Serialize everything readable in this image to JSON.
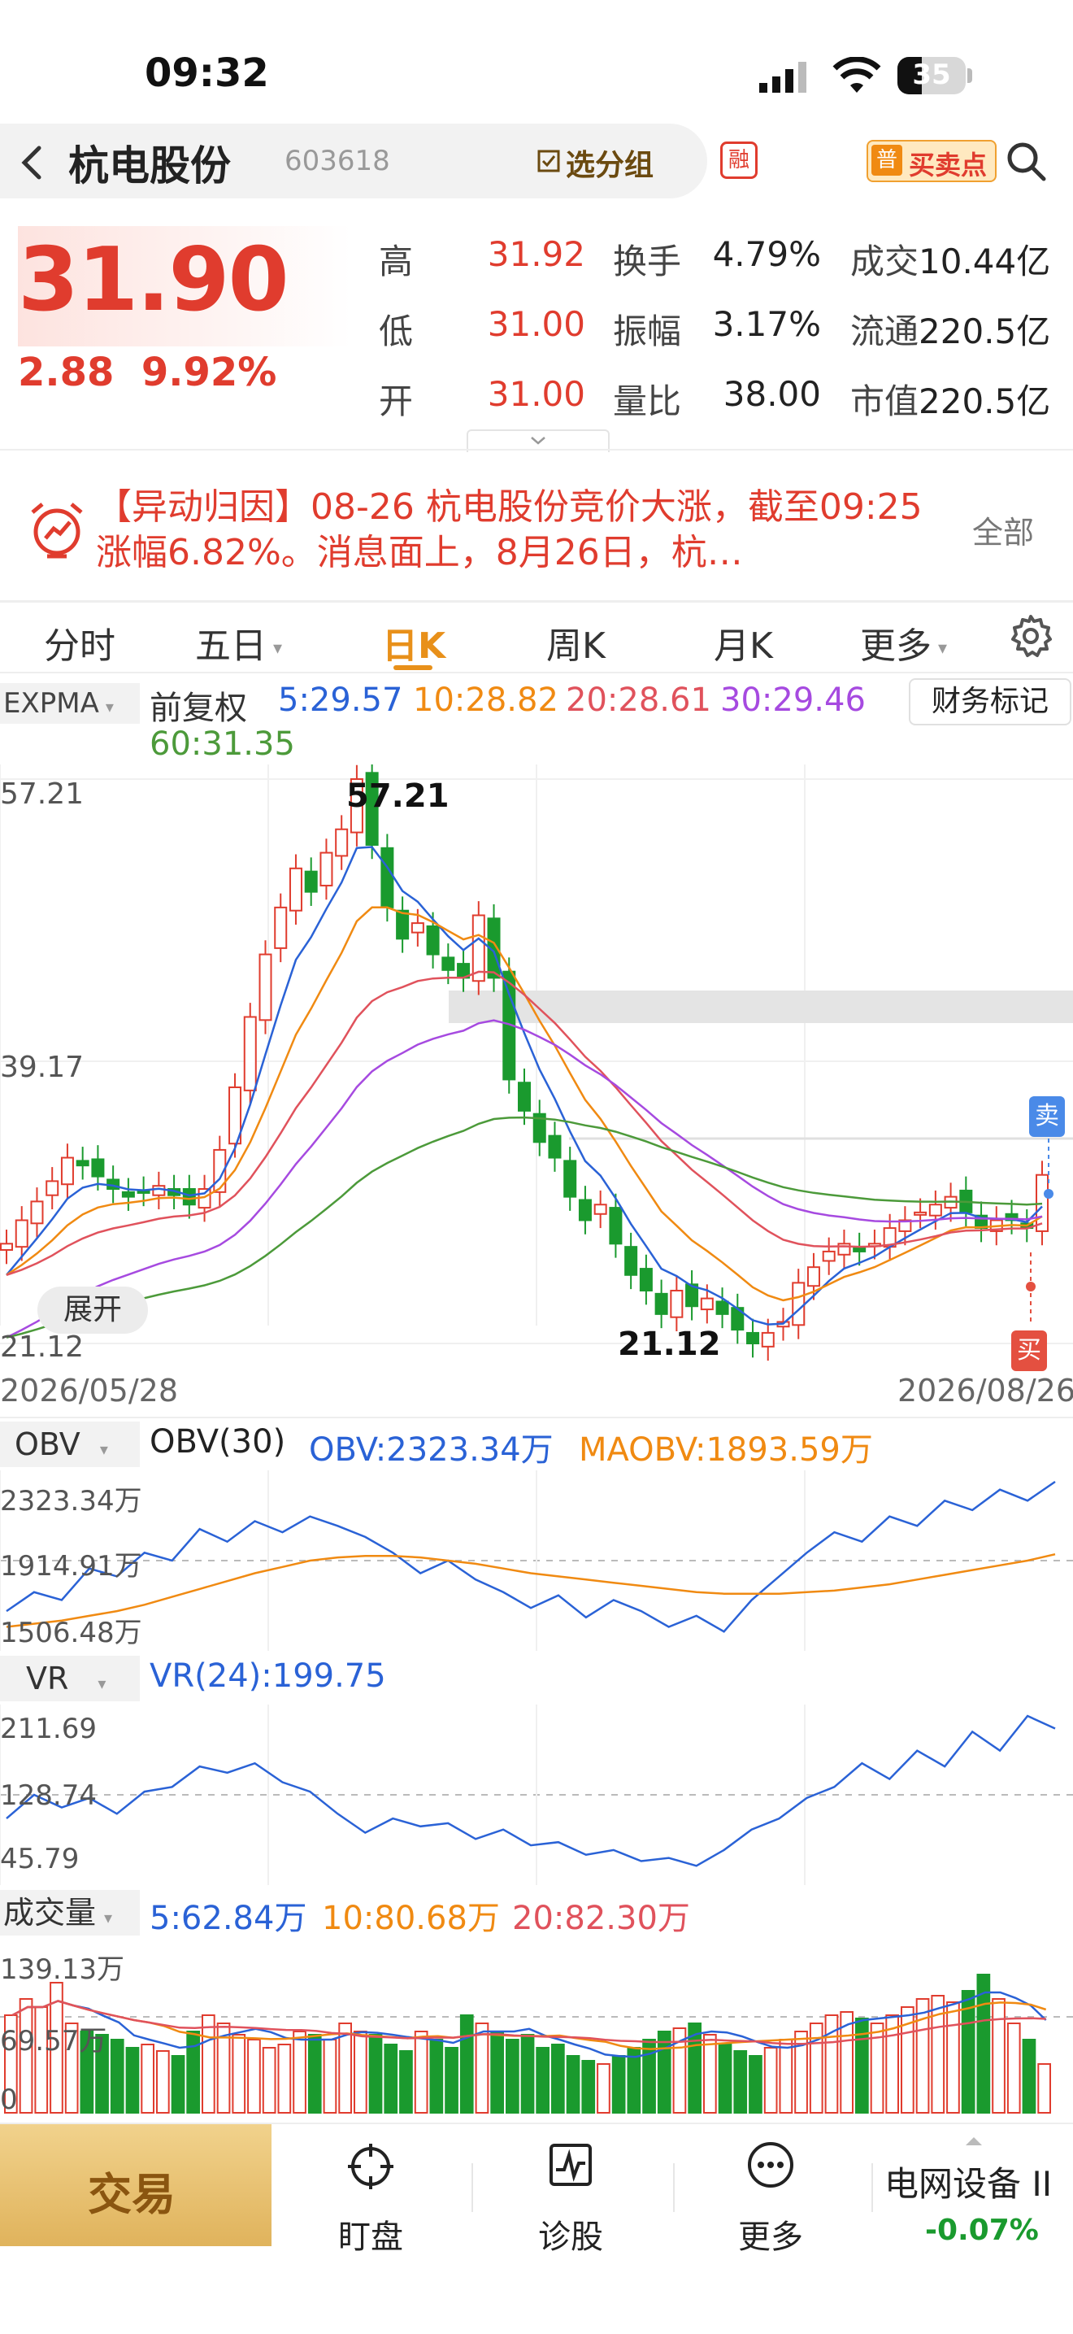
{
  "status_bar": {
    "time": "09:32",
    "battery": "35"
  },
  "header": {
    "back_icon": "chevron-left-icon",
    "stock_name": "杭电股份",
    "stock_code": "603618",
    "watchlist_label": "选分组",
    "margin_badge": "融",
    "pu_badge": "普",
    "buy_sell_label": "买卖点",
    "search_icon": "search-icon"
  },
  "quote": {
    "price": "31.90",
    "change": "2.88",
    "change_pct": "9.92%",
    "high_label": "高",
    "high": "31.92",
    "low_label": "低",
    "low": "31.00",
    "open_label": "开",
    "open": "31.00",
    "turnover_label": "换手",
    "turnover": "4.79%",
    "amplitude_label": "振幅",
    "amplitude": "3.17%",
    "volume_ratio_label": "量比",
    "volume_ratio": "38.00",
    "amount_label": "成交",
    "amount": "10.44亿",
    "float_label": "流通",
    "float_cap": "220.5亿",
    "mcap_label": "市值",
    "mcap": "220.5亿"
  },
  "news": {
    "text": "【异动归因】08-26 杭电股份竞价大涨，截至09:25 涨幅6.82%。消息面上，8月26日，杭…",
    "all_label": "全部"
  },
  "tabs": [
    "分时",
    "五日",
    "日K",
    "周K",
    "月K",
    "更多"
  ],
  "active_tab": "日K",
  "kline": {
    "indicator": "EXPMA",
    "adjust": "前复权",
    "ma5": "5:29.57",
    "ma10": "10:28.82",
    "ma20": "20:28.61",
    "ma30": "30:29.46",
    "ma60": "60:31.35",
    "finance_mark": "财务标记",
    "y_max": "57.21",
    "y_mid": "39.17",
    "y_min": "21.12",
    "peak_label": "57.21",
    "trough_label": "21.12",
    "expand_label": "展开",
    "date_start": "2026/05/28",
    "date_end": "2026/08/26",
    "sell_badge": "卖",
    "buy_badge": "买",
    "colors": {
      "up": "#e03c2e",
      "down": "#1a9a2e",
      "ma5": "#2a62d6",
      "ma10": "#f08a12",
      "ma20": "#e0525c",
      "ma30": "#a64ae0",
      "ma60": "#4c9a3a"
    }
  },
  "obv": {
    "name": "OBV",
    "param": "OBV(30)",
    "value": "OBV:2323.34万",
    "ma_value": "MAOBV:1893.59万",
    "y_max": "2323.34万",
    "y_mid": "1914.91万",
    "y_min": "1506.48万"
  },
  "vr": {
    "name": "VR",
    "value": "VR(24):199.75",
    "y_max": "211.69",
    "y_mid": "128.74",
    "y_min": "45.79"
  },
  "volume": {
    "name": "成交量",
    "ma5": "5:62.84万",
    "ma10": "10:80.68万",
    "ma20": "20:82.30万",
    "y_max": "139.13万",
    "y_mid": "69.57万",
    "y_min": "0"
  },
  "bottom_nav": {
    "trade": "交易",
    "watch": "盯盘",
    "diagnose": "诊股",
    "more": "更多",
    "sector": "电网设备 II",
    "sector_pct": "-0.07%"
  },
  "chart_data": {
    "type": "candlestick",
    "title": "",
    "x_range": [
      "2026/05/28",
      "2026/08/26"
    ],
    "ylim": [
      21.12,
      57.21
    ],
    "close_approx": [
      27.5,
      29.0,
      30.2,
      31.5,
      33.0,
      32.5,
      31.8,
      31.0,
      30.5,
      30.8,
      31.2,
      30.6,
      30.0,
      31.0,
      33.5,
      37.5,
      42.0,
      46.0,
      49.0,
      51.5,
      50.0,
      52.5,
      54.0,
      57.21,
      53.0,
      49.0,
      47.0,
      48.0,
      46.0,
      45.0,
      44.5,
      48.5,
      44.5,
      38.0,
      36.0,
      34.0,
      33.0,
      30.5,
      29.0,
      30.0,
      27.5,
      25.5,
      24.5,
      23.0,
      24.5,
      23.5,
      24.0,
      23.0,
      22.0,
      21.12,
      21.8,
      22.5,
      25.0,
      26.0,
      27.0,
      27.5,
      27.0,
      27.5,
      28.5,
      29.0,
      29.5,
      30.0,
      30.5,
      29.5,
      28.5,
      29.0,
      29.0,
      28.5,
      31.9
    ]
  }
}
